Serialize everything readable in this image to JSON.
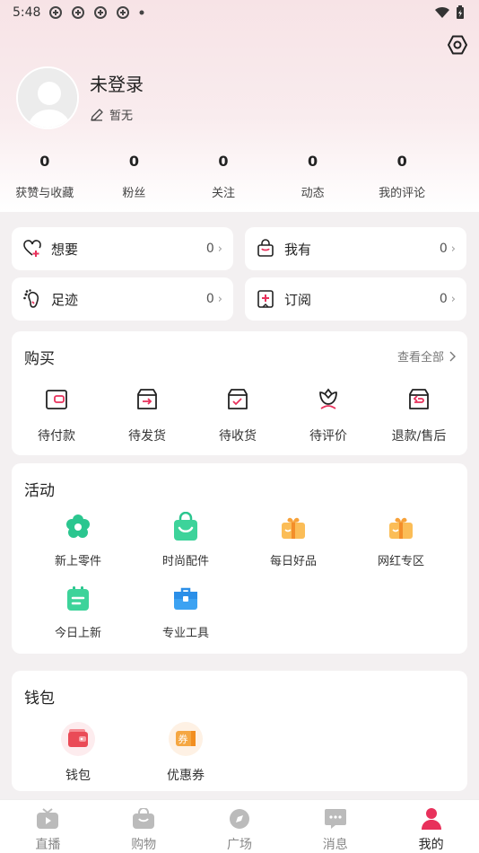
{
  "status_bar": {
    "time": "5:48"
  },
  "profile": {
    "username": "未登录",
    "bio": "暂无"
  },
  "stats": [
    {
      "value": "0",
      "label": "获赞与收藏"
    },
    {
      "value": "0",
      "label": "粉丝"
    },
    {
      "value": "0",
      "label": "关注"
    },
    {
      "value": "0",
      "label": "动态"
    },
    {
      "value": "0",
      "label": "我的评论"
    }
  ],
  "quick": {
    "want": {
      "label": "想要",
      "count": "0"
    },
    "have": {
      "label": "我有",
      "count": "0"
    },
    "footprint": {
      "label": "足迹",
      "count": "0"
    },
    "subscribe": {
      "label": "订阅",
      "count": "0"
    }
  },
  "purchase": {
    "title": "购买",
    "view_all": "查看全部",
    "items": [
      {
        "label": "待付款",
        "icon": "wallet-pay-icon"
      },
      {
        "label": "待发货",
        "icon": "ship-box-icon"
      },
      {
        "label": "待收货",
        "icon": "receive-box-icon"
      },
      {
        "label": "待评价",
        "icon": "review-flower-icon"
      },
      {
        "label": "退款/售后",
        "icon": "refund-box-icon"
      }
    ]
  },
  "activity": {
    "title": "活动",
    "items": [
      {
        "label": "新上零件",
        "icon": "flower-gear-icon"
      },
      {
        "label": "时尚配件",
        "icon": "shopping-bag-icon"
      },
      {
        "label": "每日好品",
        "icon": "gift-box-icon"
      },
      {
        "label": "网红专区",
        "icon": "gift-box-icon"
      },
      {
        "label": "今日上新",
        "icon": "calendar-icon"
      },
      {
        "label": "专业工具",
        "icon": "toolbox-icon"
      }
    ]
  },
  "wallet": {
    "title": "钱包",
    "items": [
      {
        "label": "钱包",
        "icon": "wallet-icon"
      },
      {
        "label": "优惠券",
        "icon": "coupon-icon",
        "badge": "券"
      }
    ]
  },
  "nav": [
    {
      "label": "直播",
      "icon": "tv-icon"
    },
    {
      "label": "购物",
      "icon": "shopping-bag-icon"
    },
    {
      "label": "广场",
      "icon": "compass-icon"
    },
    {
      "label": "消息",
      "icon": "message-icon"
    },
    {
      "label": "我的",
      "icon": "person-icon",
      "active": true
    }
  ],
  "colors": {
    "accent": "#e8315b",
    "green": "#2bc68f",
    "orange": "#f7a23a",
    "blue": "#2b8fe8",
    "bg": "#f3f0f1"
  }
}
